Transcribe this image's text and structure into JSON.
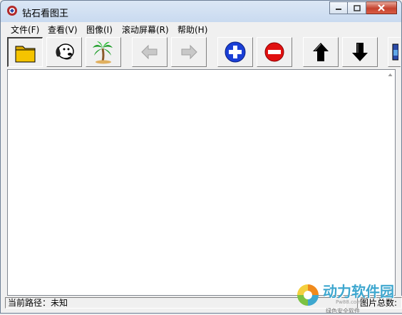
{
  "window": {
    "title": "钻石看图王"
  },
  "menu": {
    "items": [
      {
        "label": "文件(F)"
      },
      {
        "label": "查看(V)"
      },
      {
        "label": "图像(I)"
      },
      {
        "label": "滚动屏幕(R)"
      },
      {
        "label": "帮助(H)"
      }
    ]
  },
  "toolbar": {
    "buttons": [
      {
        "icon": "folder-icon",
        "state": "pressed"
      },
      {
        "icon": "dog-icon"
      },
      {
        "icon": "palm-tree-icon"
      },
      {
        "icon": "arrow-left-icon",
        "state": "disabled"
      },
      {
        "icon": "arrow-right-icon",
        "state": "disabled"
      },
      {
        "icon": "zoom-in-icon"
      },
      {
        "icon": "zoom-out-icon"
      },
      {
        "icon": "arrow-up-icon"
      },
      {
        "icon": "arrow-down-icon"
      }
    ]
  },
  "status": {
    "path_label": "当前路径：未知",
    "total_label": "图片总数:"
  },
  "watermark": {
    "text": "动力软件园",
    "url": "Pw88.com",
    "sub": "绿色安全软件"
  },
  "colors": {
    "zoom_blue": "#1a3fd6",
    "zoom_red": "#e01010",
    "folder_yellow": "#f5c400"
  }
}
